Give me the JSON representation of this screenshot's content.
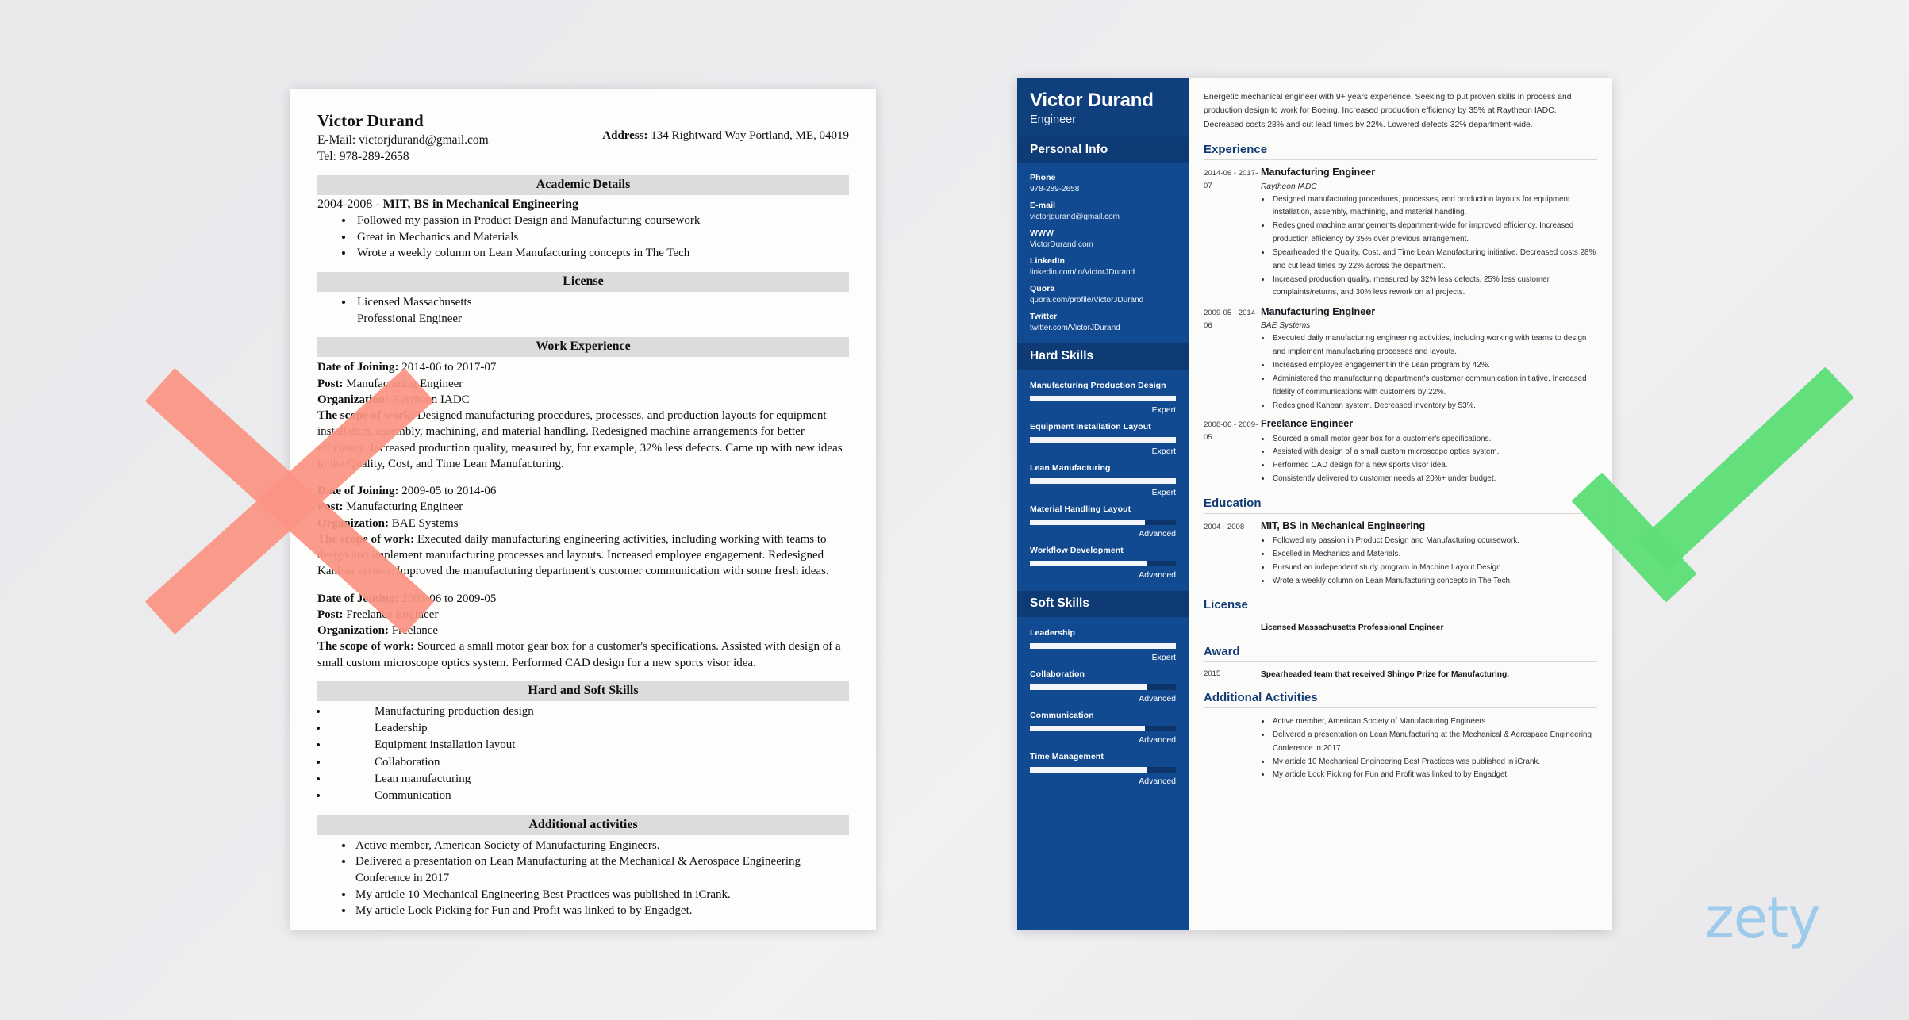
{
  "bad_resume": {
    "name": "Victor Durand",
    "email_line": "E-Mail: victorjdurand@gmail.com",
    "tel_line": "Tel: 978-289-2658",
    "address_label": "Address:",
    "address_value": "134 Rightward Way Portland, ME, 04019",
    "sections": {
      "academic": "Academic Details",
      "license": "License",
      "work": "Work Experience",
      "skills": "Hard and Soft Skills",
      "activities": "Additional activities"
    },
    "academic": {
      "years": "2004-2008 - ",
      "degree": "MIT, BS in Mechanical Engineering",
      "bullets": [
        "Followed my passion in Product Design and Manufacturing coursework",
        "Great in Mechanics and Materials",
        "Wrote a weekly column on Lean Manufacturing concepts in The Tech"
      ]
    },
    "license_bullets": [
      "Licensed Massachusetts Professional Engineer"
    ],
    "work": [
      {
        "date_label": "Date of Joining:",
        "date_value": " 2014-06 to 2017-07",
        "post_label": "Post:",
        "post_value": " Manufacturing Engineer",
        "org_label": "Organization:",
        "org_value": " Raytheon IADC",
        "scope_label": "The scope of work:",
        "scope_value": " Designed manufacturing procedures, processes, and production layouts for equipment installation, assembly, machining, and material handling. Redesigned machine arrangements for better efficiency. Increased production quality, measured by, for example, 32% less defects. Came up with new ideas in the Quality, Cost, and Time Lean Manufacturing."
      },
      {
        "date_label": "Date of Joining:",
        "date_value": " 2009-05 to 2014-06",
        "post_label": "Post:",
        "post_value": " Manufacturing Engineer",
        "org_label": "Organization:",
        "org_value": " BAE Systems",
        "scope_label": "The scope of work:",
        "scope_value": " Executed daily manufacturing engineering activities, including working with teams to design and implement manufacturing processes and layouts. Increased employee engagement. Redesigned Kanban system. Improved the manufacturing department's customer communication with some fresh ideas."
      },
      {
        "date_label": "Date of Joining:",
        "date_value": " 2008-06 to 2009-05",
        "post_label": "Post:",
        "post_value": " Freelance Engineer",
        "org_label": "Organization:",
        "org_value": " Freelance",
        "scope_label": "The scope of work:",
        "scope_value": " Sourced a small motor gear box for a customer's specifications. Assisted with design of a small custom microscope optics system. Performed CAD design for a new sports visor idea."
      }
    ],
    "skills": [
      "Manufacturing production design",
      "Leadership",
      "Equipment installation layout",
      "Collaboration",
      "Lean manufacturing",
      "Communication"
    ],
    "activities": [
      "Active member, American Society of Manufacturing Engineers.",
      "Delivered a presentation on Lean Manufacturing at the Mechanical & Aerospace Engineering Conference in 2017",
      "My article 10 Mechanical Engineering Best Practices was published in iCrank.",
      "My article Lock Picking for Fun and Profit was linked to by Engadget."
    ]
  },
  "good_resume": {
    "name": "Victor Durand",
    "role": "Engineer",
    "sidebar": {
      "personal_info_title": "Personal Info",
      "contacts": [
        {
          "label": "Phone",
          "value": "978-289-2658"
        },
        {
          "label": "E-mail",
          "value": "victorjdurand@gmail.com"
        },
        {
          "label": "WWW",
          "value": "VictorDurand.com"
        },
        {
          "label": "LinkedIn",
          "value": "linkedin.com/in/VictorJDurand"
        },
        {
          "label": "Quora",
          "value": "quora.com/profile/VictorJDurand"
        },
        {
          "label": "Twitter",
          "value": "twitter.com/VictorJDurand"
        }
      ],
      "hard_skills_title": "Hard Skills",
      "hard_skills": [
        {
          "name": "Manufacturing Production Design",
          "level": "Expert",
          "pct": 100
        },
        {
          "name": "Equipment Installation Layout",
          "level": "Expert",
          "pct": 100
        },
        {
          "name": "Lean Manufacturing",
          "level": "Expert",
          "pct": 100
        },
        {
          "name": "Material Handling Layout",
          "level": "Advanced",
          "pct": 79
        },
        {
          "name": "Workflow Development",
          "level": "Advanced",
          "pct": 80
        }
      ],
      "soft_skills_title": "Soft Skills",
      "soft_skills": [
        {
          "name": "Leadership",
          "level": "Expert",
          "pct": 100
        },
        {
          "name": "Collaboration",
          "level": "Advanced",
          "pct": 80
        },
        {
          "name": "Communication",
          "level": "Advanced",
          "pct": 79
        },
        {
          "name": "Time Management",
          "level": "Advanced",
          "pct": 80
        }
      ]
    },
    "summary": "Energetic mechanical engineer with 9+ years experience. Seeking to put proven skills in process and production design to work for Boeing. Increased production efficiency by 35% at Raytheon IADC. Decreased costs 28% and cut lead times by 22%. Lowered defects 32% department-wide.",
    "sections": {
      "experience": "Experience",
      "education": "Education",
      "license": "License",
      "award": "Award",
      "additional": "Additional Activities"
    },
    "experience": [
      {
        "date": "2014-06 - 2017-07",
        "title": "Manufacturing Engineer",
        "org": "Raytheon IADC",
        "bullets": [
          "Designed manufacturing procedures, processes, and production layouts for equipment installation, assembly, machining, and material handling.",
          "Redesigned machine arrangements department-wide for improved efficiency. Increased production efficiency by 35% over previous arrangement.",
          "Spearheaded the Quality, Cost, and Time Lean Manufacturing initiative. Decreased costs 28% and cut lead times by 22% across the department.",
          "Increased production quality, measured by 32% less defects, 25% less customer complaints/returns, and 30% less rework on all projects."
        ]
      },
      {
        "date": "2009-05 - 2014-06",
        "title": "Manufacturing Engineer",
        "org": "BAE Systems",
        "bullets": [
          "Executed daily manufacturing engineering activities, including working with teams to design and implement manufacturing processes and layouts.",
          "Increased employee engagement in the Lean program by 42%.",
          "Administered the manufacturing department's customer communication initiative. Increased fidelity of communications with customers by 22%.",
          "Redesigned Kanban system. Decreased inventory by 53%."
        ]
      },
      {
        "date": "2008-06 - 2009-05",
        "title": "Freelance Engineer",
        "org": "",
        "bullets": [
          "Sourced a small motor gear box for a customer's specifications.",
          "Assisted with design of a small custom microscope optics system.",
          "Performed CAD design for a new sports visor idea.",
          "Consistently delivered to customer needs at 20%+ under budget."
        ]
      }
    ],
    "education": [
      {
        "date": "2004 - 2008",
        "title": "MIT, BS in Mechanical Engineering",
        "bullets": [
          "Followed my passion in Product Design and Manufacturing coursework.",
          "Excelled in Mechanics and Materials.",
          "Pursued an independent study program in Machine Layout Design.",
          "Wrote a weekly column on Lean Manufacturing concepts in The Tech."
        ]
      }
    ],
    "license": {
      "date": "",
      "text": "Licensed Massachusetts Professional Engineer"
    },
    "award": {
      "date": "2015",
      "text": "Spearheaded team that received Shingo Prize for Manufacturing."
    },
    "additional": [
      "Active member, American Society of Manufacturing Engineers.",
      "Delivered a presentation on Lean Manufacturing at the Mechanical & Aerospace Engineering Conference in 2017.",
      "My article 10 Mechanical Engineering Best Practices was published in iCrank.",
      "My article Lock Picking for Fun and Profit was linked to by Engadget."
    ]
  },
  "marks": {
    "reject_icon": "x-mark",
    "accept_icon": "check-mark",
    "reject_color": "#fb9383",
    "accept_color": "#5ede78"
  },
  "watermark": {
    "text": "zety",
    "color": "#9ecbec"
  }
}
